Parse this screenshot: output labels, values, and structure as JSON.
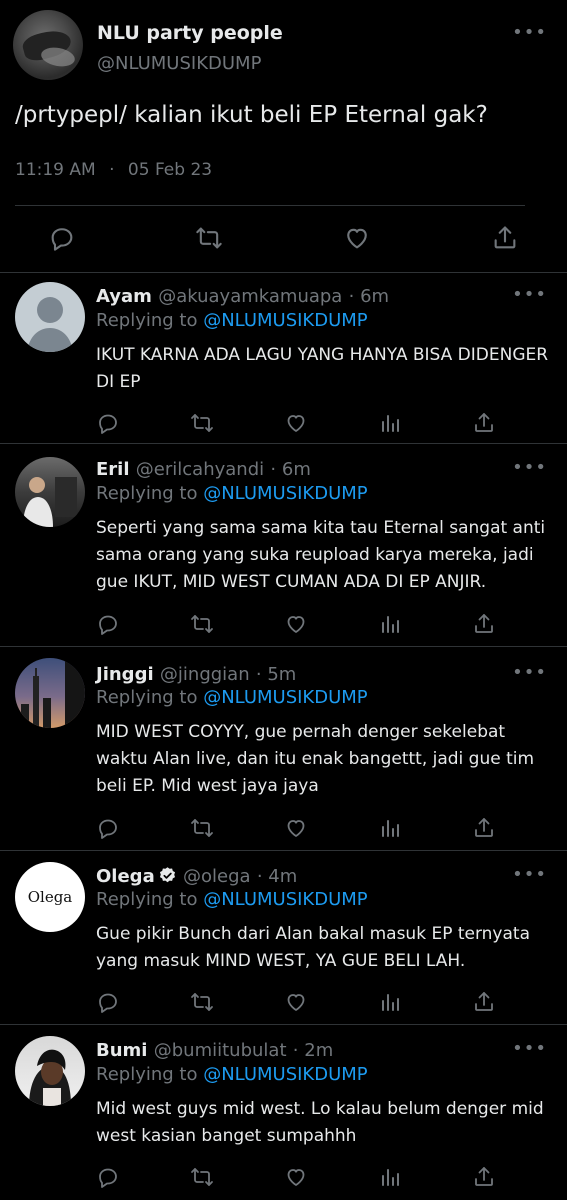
{
  "main_tweet": {
    "name": "NLU party people",
    "handle": "@NLUMUSIKDUMP",
    "text": "/prtypepl/ kalian ikut beli EP Eternal gak?",
    "time": "11:19 AM",
    "separator": "·",
    "date": "05 Feb 23"
  },
  "icons": {
    "more": "more-horizontal-icon",
    "reply": "reply-icon",
    "retweet": "retweet-icon",
    "like": "like-icon",
    "views": "views-icon",
    "share": "share-icon",
    "verified": "verified-badge-icon"
  },
  "colors": {
    "background": "#000000",
    "text": "#e7e9ea",
    "muted": "#71767b",
    "link": "#1d9bf0",
    "divider": "#2f3336"
  },
  "replies": [
    {
      "name": "Ayam",
      "handle": "@akuayamkamuapa",
      "time": "· 6m",
      "replying_prefix": "Replying to",
      "replying_to": "@NLUMUSIKDUMP",
      "text_lines": [
        "IKUT KARNA ADA LAGU YANG HANYA BISA DIDENGER",
        "DI EP"
      ]
    },
    {
      "name": "Eril",
      "handle": "@erilcahyandi",
      "time": "· 6m",
      "replying_prefix": "Replying to",
      "replying_to": "@NLUMUSIKDUMP",
      "text_lines": [
        "Seperti yang sama sama kita tau Eternal sangat anti",
        "sama orang yang suka reupload karya mereka, jadi",
        "gue IKUT, MID WEST CUMAN ADA DI EP ANJIR."
      ]
    },
    {
      "name": "Jinggi",
      "handle": "@jinggian",
      "time": "· 5m",
      "replying_prefix": "Replying to",
      "replying_to": "@NLUMUSIKDUMP",
      "text_lines": [
        "MID WEST COYYY, gue pernah denger sekelebat",
        "waktu Alan live, dan itu enak bangettt, jadi gue tim",
        "beli EP. Mid west jaya jaya"
      ]
    },
    {
      "name": "Olega",
      "handle": "@olega",
      "time": "· 4m",
      "avatar_text": "Olega",
      "replying_prefix": "Replying to",
      "replying_to": "@NLUMUSIKDUMP",
      "text_lines": [
        "Gue pikir Bunch dari Alan bakal masuk EP ternyata",
        "yang masuk MIND WEST, YA GUE BELI LAH."
      ]
    },
    {
      "name": "Bumi",
      "handle": "@bumiitubulat",
      "time": "· 2m",
      "replying_prefix": "Replying to",
      "replying_to": "@NLUMUSIKDUMP",
      "text_lines": [
        "Mid west guys mid west. Lo kalau belum denger mid",
        "west kasian banget sumpahhh"
      ]
    }
  ]
}
